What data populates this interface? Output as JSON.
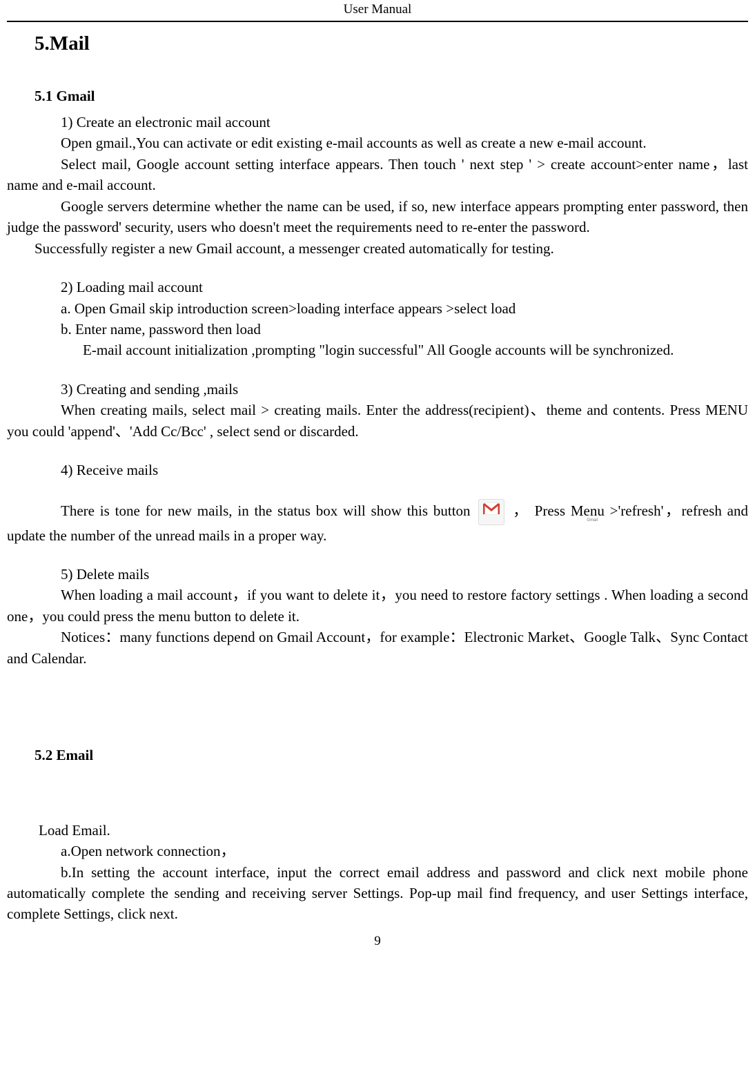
{
  "header": {
    "title": "User    Manual"
  },
  "section": {
    "title": "5.Mail"
  },
  "gmail": {
    "heading": "5.1 Gmail",
    "p1": "1) Create an electronic mail account",
    "p2": "Open gmail.,You can activate or edit existing e-mail accounts as well as create a new e-mail account.",
    "p3": "Select mail, Google account setting interface appears. Then touch ' next step ' > create account>enter name，last name and e-mail account.",
    "p4": "Google servers determine whether the name can be used, if so, new interface appears prompting enter password, then judge the password' security, users who doesn't meet the requirements need to re-enter the password.",
    "p5": "Successfully register a new Gmail account, a messenger created automatically for testing.",
    "p6": "2) Loading mail account",
    "p7": "a. Open Gmail skip introduction screen>loading interface appears >select load",
    "p8": "b. Enter name, password then load",
    "p9": "E-mail account initialization ,prompting \"login successful\" All Google accounts will be synchronized.",
    "p10": "3) Creating and sending ,mails",
    "p11": "When creating mails, select mail > creating mails. Enter the address(recipient)、theme and contents. Press MENU you could  'append'、'Add Cc/Bcc' ,   select send or discarded.",
    "p12": "4) Receive mails",
    "p13a": "There is tone for new mails, in the status box will show this button",
    "p13b": "， Press Menu >'refresh'，refresh and update the number of the unread mails in a proper way.",
    "p14": "5) Delete   mails",
    "p15": "When loading a mail account，if you want to delete it，you need to restore factory settings . When loading a second one，you could press the menu button to delete it.",
    "p16": "Notices：many functions depend on Gmail Account，for example：Electronic Market、Google Talk、Sync Contact and Calendar."
  },
  "email": {
    "heading": "5.2 Email",
    "p1": "Load Email.",
    "p2": "a.Open network connection，",
    "p3": "b.In setting the account interface, input the correct email address and password and click next mobile phone automatically complete the sending and receiving server Settings. Pop-up mail find frequency, and user Settings interface, complete Settings, click next."
  },
  "icon": {
    "gmail_label": "Gmail"
  },
  "footer": {
    "page_number": "9"
  }
}
